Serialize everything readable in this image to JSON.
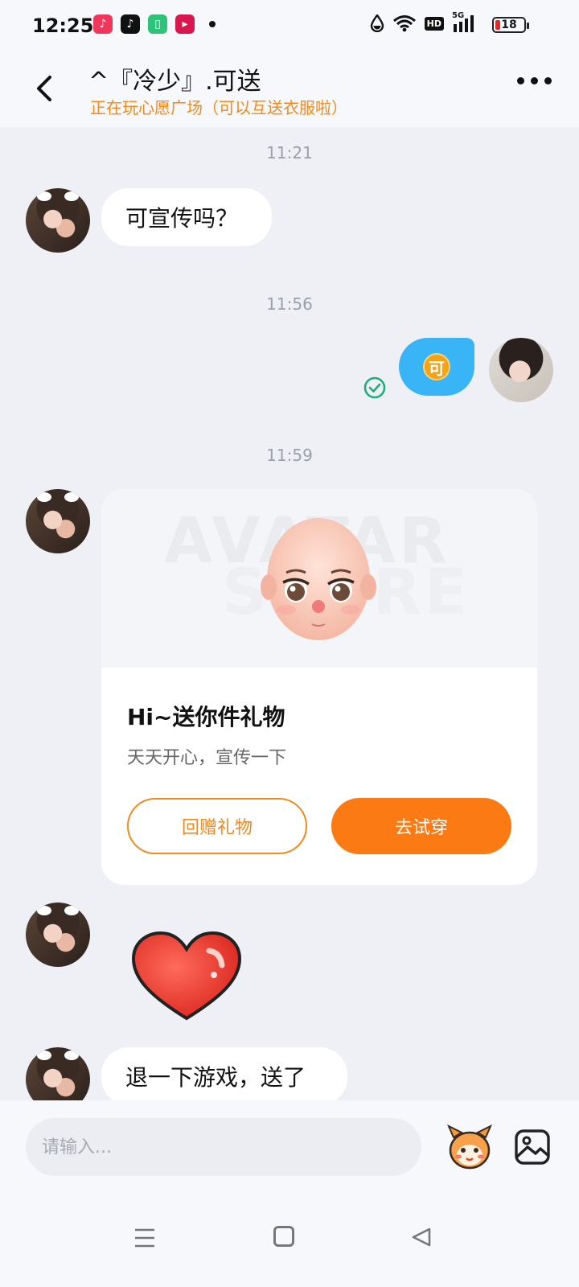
{
  "status_bar": {
    "time": "12:25",
    "apps": [
      {
        "name": "music-app-icon",
        "glyph": "♪",
        "color": "#f0365a"
      },
      {
        "name": "tiktok-app-icon",
        "glyph": "♪",
        "color": "#111111"
      },
      {
        "name": "battery-app-icon",
        "glyph": "▯",
        "color": "#2fc27a"
      },
      {
        "name": "video-app-icon",
        "glyph": "▸",
        "color": "#d9164e"
      }
    ],
    "network_badges": [
      "HD",
      "5G"
    ],
    "battery_level": "18"
  },
  "header": {
    "title": "^『冷少』.可送",
    "subtitle": "正在玩心愿广场（可以互送衣服啦）"
  },
  "messages": {
    "ts1": "11:21",
    "msg1": "可宣传吗？",
    "ts2": "11:56",
    "self_coin_text": "可",
    "ts3": "11:59",
    "gift": {
      "watermark_line1": "AVATAR",
      "watermark_line2": "STORE",
      "title": "Hi~送你件礼物",
      "desc": "天天开心，宣传一下",
      "btn_return": "回赠礼物",
      "btn_try": "去试穿"
    },
    "msg_last": "退一下游戏，送了"
  },
  "input": {
    "placeholder": "请输入..."
  },
  "colors": {
    "accent": "#fb7a14",
    "subtitle": "#f08a1c",
    "self_bubble": "#38b4f7",
    "read_check": "#1fae77"
  }
}
